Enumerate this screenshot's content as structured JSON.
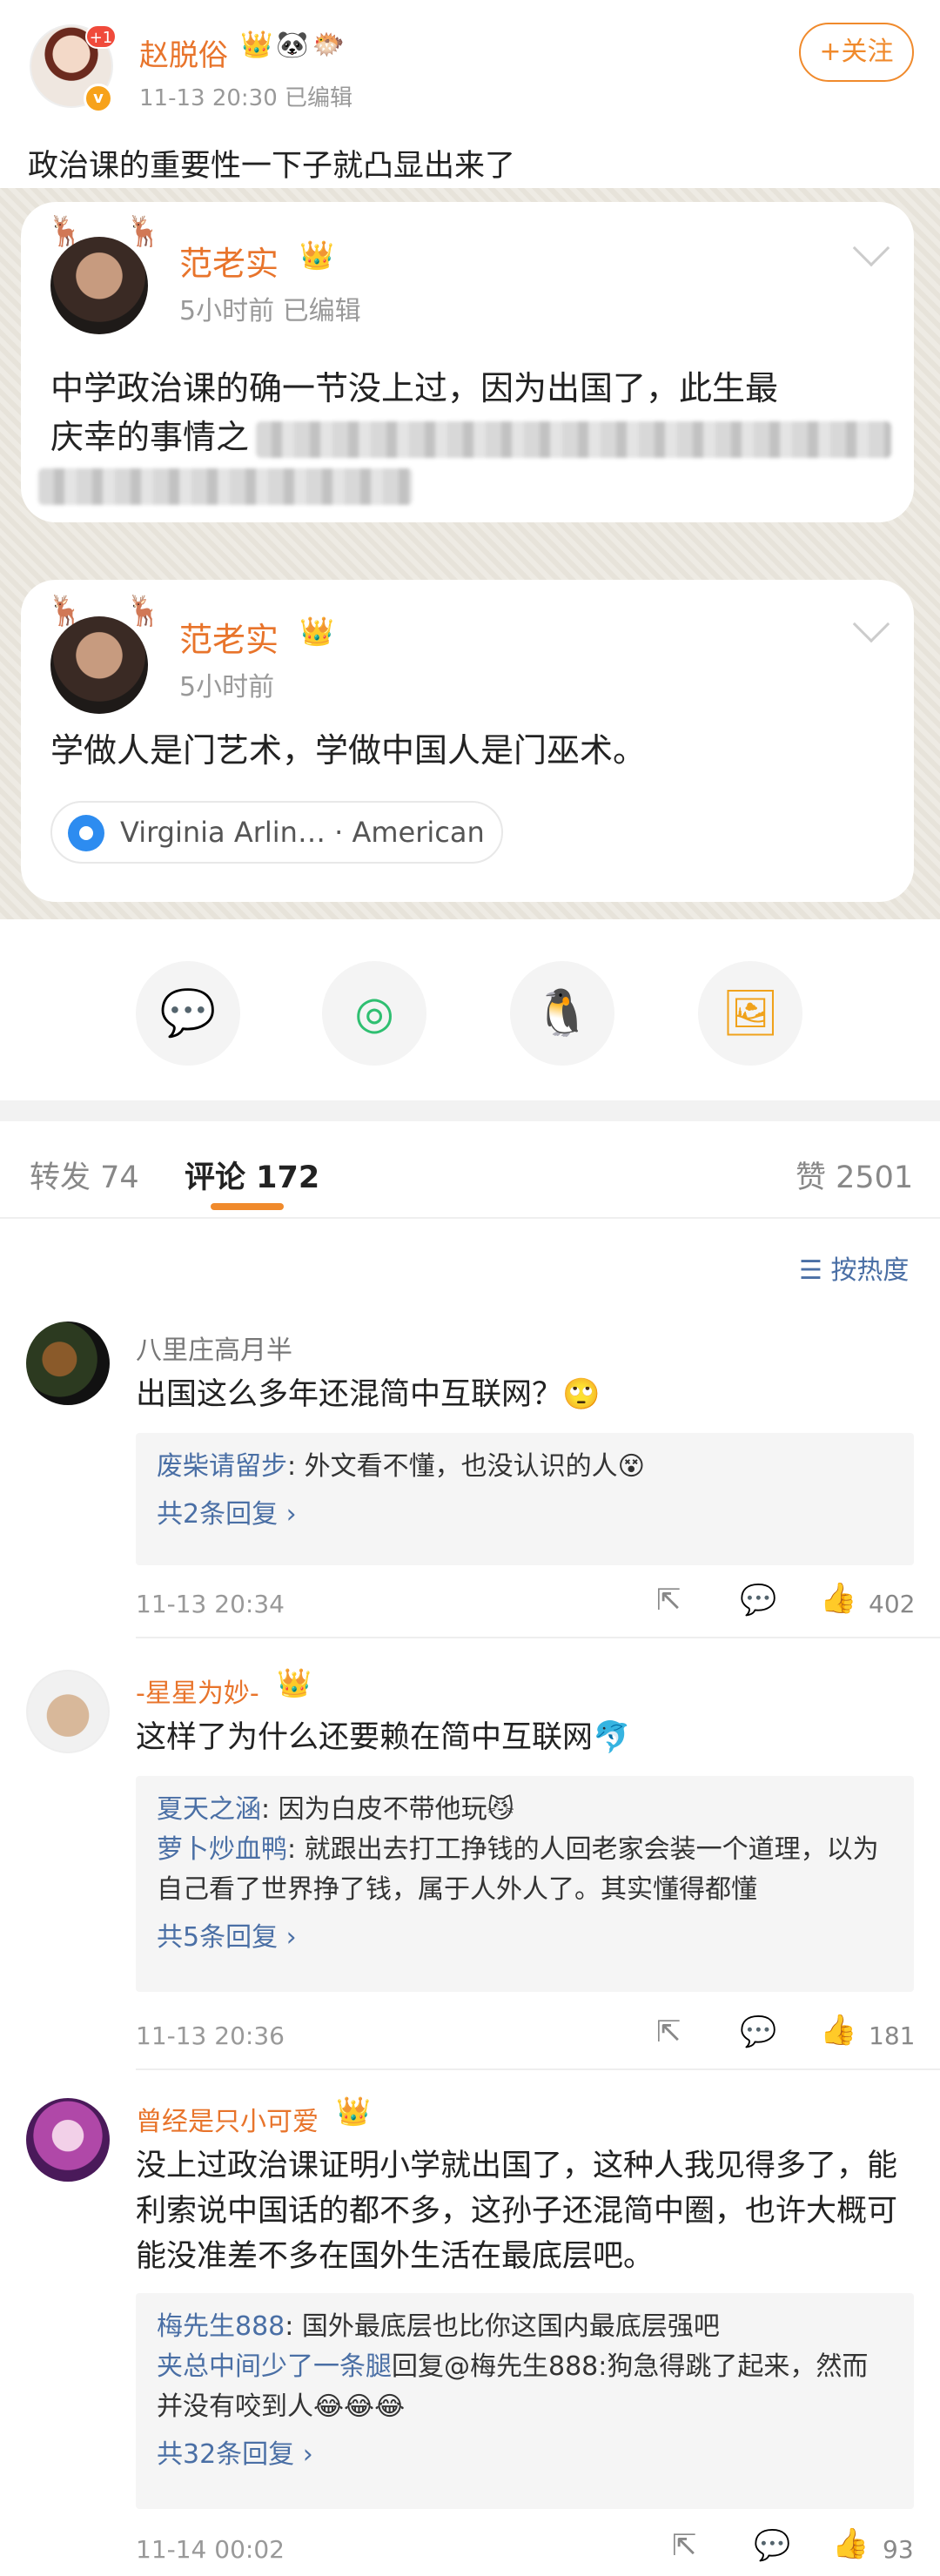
{
  "post": {
    "author": "赵脱俗",
    "author_badges": "👑🐼🐡",
    "plus_badge": "+1",
    "meta": "11-13 20:30   已编辑",
    "follow": "+关注",
    "text": "政治课的重要性一下子就凸显出来了"
  },
  "cards": [
    {
      "name": "范老实",
      "meta": "5小时前   已编辑",
      "line1": "中学政治课的确一节没上过，因为出国了，此生最",
      "line2": "庆幸的事情之一，"
    },
    {
      "name": "范老实",
      "meta": "5小时前",
      "text": "学做人是门艺术，学做中国人是门巫术。",
      "location": "Virginia Arlin… · American"
    }
  ],
  "share_icons": [
    "wechat-icon",
    "moments-icon",
    "qq-icon",
    "save-image-icon"
  ],
  "tabs": {
    "repost": "转发 74",
    "comments": "评论 172",
    "likes": "赞 2501",
    "sort": "按热度"
  },
  "comments": [
    {
      "name": "八里庄高月半",
      "text": "出国这么多年还混简中互联网？🙄",
      "replies": [
        {
          "user": "废柴请留步",
          "text": ": 外文看不懂，也没认识的人😵"
        }
      ],
      "more": "共2条回复 ›",
      "time": "11-13 20:34",
      "likes": "402"
    },
    {
      "name": "-星星为妙-",
      "text": "这样了为什么还要赖在简中互联网🐬",
      "replies": [
        {
          "user": "夏天之涵",
          "text": ": 因为白皮不带他玩😼"
        },
        {
          "user": "萝卜炒血鸭",
          "text": ": 就跟出去打工挣钱的人回老家会装一个道理，以为自己看了世界挣了钱，属于人外人了。其实懂得都懂"
        }
      ],
      "more": "共5条回复 ›",
      "time": "11-13 20:36",
      "likes": "181"
    },
    {
      "name": "曾经是只小可爱",
      "text": "没上过政治课证明小学就出国了，这种人我见得多了，能利索说中国话的都不多，这孙子还混简中圈，也许大概可能没准差不多在国外生活在最底层吧。",
      "replies": [
        {
          "user": "梅先生888",
          "text": ": 国外最底层也比你这国内最底层强吧"
        },
        {
          "user": "夹总中间少了一条腿",
          "text": "回复@梅先生888:狗急得跳了起来，然而并没有咬到人😂😂😂"
        }
      ],
      "more": "共32条回复 ›",
      "time": "11-14 00:02",
      "likes": "93"
    }
  ]
}
